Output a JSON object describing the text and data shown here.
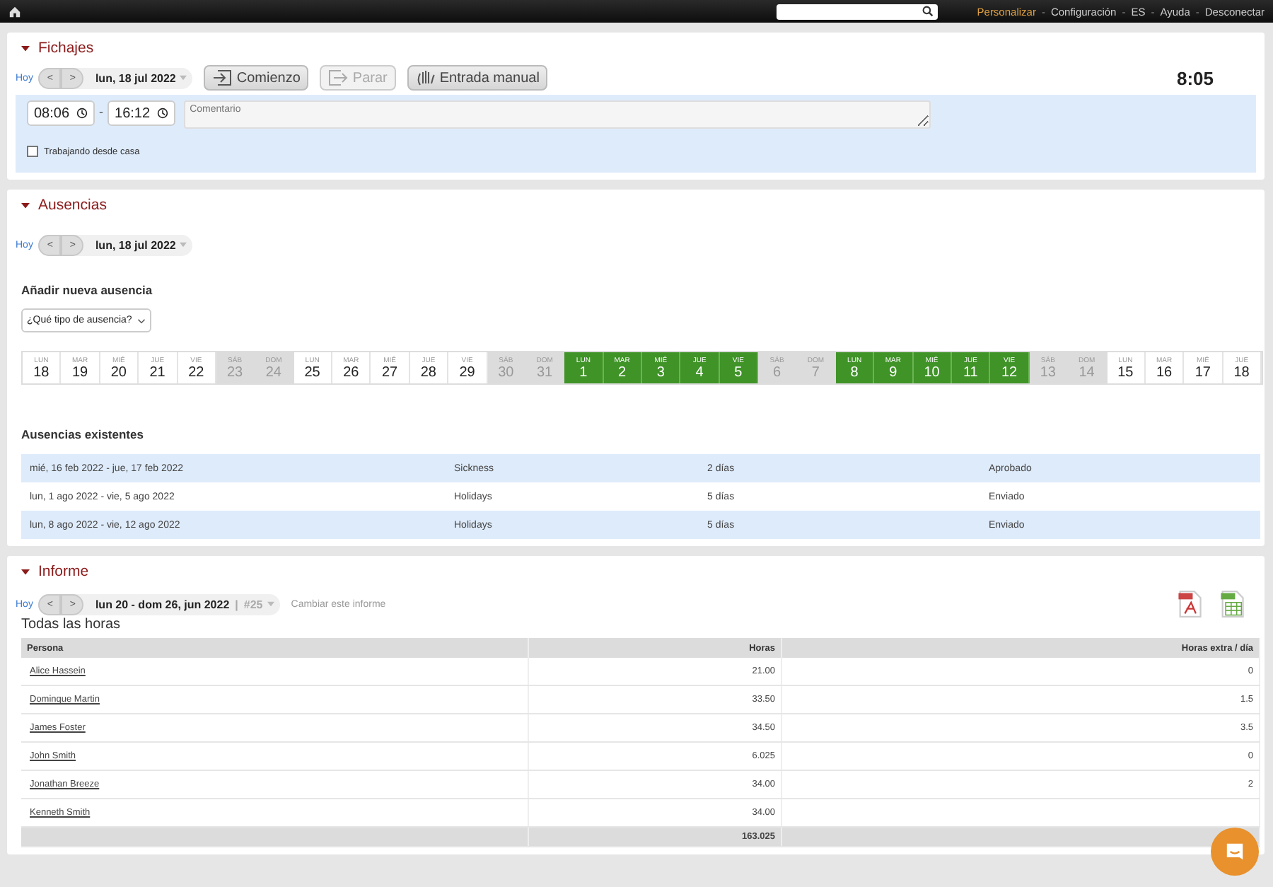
{
  "topbar": {
    "separator": "-",
    "links": [
      {
        "label": "Personalizar",
        "selected": true
      },
      {
        "label": "Configuración",
        "selected": false
      },
      {
        "label": "ES",
        "selected": false
      },
      {
        "label": "Ayuda",
        "selected": false
      },
      {
        "label": "Desconectar",
        "selected": false
      }
    ]
  },
  "fichajes": {
    "title": "Fichajes",
    "expanded": true,
    "today": "Hoy",
    "prev": "<",
    "next": ">",
    "date": "lun, 18 jul 2022",
    "buttons": [
      {
        "label": "Comienzo",
        "disabled": false,
        "kind": "start"
      },
      {
        "label": "Parar",
        "disabled": true,
        "kind": "stop"
      },
      {
        "label": "Entrada manual",
        "disabled": false,
        "kind": "manual"
      }
    ],
    "timer": "8:05",
    "start_time": "08:06",
    "time_separator": "-",
    "end_time": "16:12",
    "comment": {
      "placeholder": "Comentario"
    },
    "home_office": {
      "label": "Trabajando desde casa",
      "checked": false
    }
  },
  "ausencias": {
    "title": "Ausencias",
    "expanded": true,
    "today": "Hoy",
    "prev": "<",
    "next": ">",
    "date": "lun, 18 jul 2022",
    "add_heading": "Añadir nueva ausencia",
    "type_select": "¿Qué tipo de ausencia?",
    "days": [
      {
        "weekday": "LUN",
        "day": "18",
        "kind": "work"
      },
      {
        "weekday": "MAR",
        "day": "19",
        "kind": "work"
      },
      {
        "weekday": "MIÉ",
        "day": "20",
        "kind": "work"
      },
      {
        "weekday": "JUE",
        "day": "21",
        "kind": "work"
      },
      {
        "weekday": "VIE",
        "day": "22",
        "kind": "work"
      },
      {
        "weekday": "SÁB",
        "day": "23",
        "kind": "weekend"
      },
      {
        "weekday": "DOM",
        "day": "24",
        "kind": "weekend"
      },
      {
        "weekday": "LUN",
        "day": "25",
        "kind": "work"
      },
      {
        "weekday": "MAR",
        "day": "26",
        "kind": "work"
      },
      {
        "weekday": "MIÉ",
        "day": "27",
        "kind": "work"
      },
      {
        "weekday": "JUE",
        "day": "28",
        "kind": "work"
      },
      {
        "weekday": "VIE",
        "day": "29",
        "kind": "work"
      },
      {
        "weekday": "SÁB",
        "day": "30",
        "kind": "weekend"
      },
      {
        "weekday": "DOM",
        "day": "31",
        "kind": "weekend"
      },
      {
        "weekday": "LUN",
        "day": "1",
        "kind": "absence"
      },
      {
        "weekday": "MAR",
        "day": "2",
        "kind": "absence"
      },
      {
        "weekday": "MIÉ",
        "day": "3",
        "kind": "absence"
      },
      {
        "weekday": "JUE",
        "day": "4",
        "kind": "absence"
      },
      {
        "weekday": "VIE",
        "day": "5",
        "kind": "absence"
      },
      {
        "weekday": "SÁB",
        "day": "6",
        "kind": "weekend"
      },
      {
        "weekday": "DOM",
        "day": "7",
        "kind": "weekend"
      },
      {
        "weekday": "LUN",
        "day": "8",
        "kind": "absence"
      },
      {
        "weekday": "MAR",
        "day": "9",
        "kind": "absence"
      },
      {
        "weekday": "MIÉ",
        "day": "10",
        "kind": "absence"
      },
      {
        "weekday": "JUE",
        "day": "11",
        "kind": "absence"
      },
      {
        "weekday": "VIE",
        "day": "12",
        "kind": "absence"
      },
      {
        "weekday": "SÁB",
        "day": "13",
        "kind": "weekend"
      },
      {
        "weekday": "DOM",
        "day": "14",
        "kind": "weekend"
      },
      {
        "weekday": "LUN",
        "day": "15",
        "kind": "work"
      },
      {
        "weekday": "MAR",
        "day": "16",
        "kind": "work"
      },
      {
        "weekday": "MIÉ",
        "day": "17",
        "kind": "work"
      },
      {
        "weekday": "JUE",
        "day": "18",
        "kind": "work"
      }
    ],
    "existing_heading": "Ausencias existentes",
    "existing": [
      {
        "period": "mié, 16 feb 2022 - jue, 17 feb 2022",
        "type": "Sickness",
        "duration": "2 días",
        "status": "Aprobado"
      },
      {
        "period": "lun, 1 ago 2022 - vie, 5 ago 2022",
        "type": "Holidays",
        "duration": "5 días",
        "status": "Enviado"
      },
      {
        "period": "lun, 8 ago 2022 - vie, 12 ago 2022",
        "type": "Holidays",
        "duration": "5 días",
        "status": "Enviado"
      }
    ]
  },
  "informe": {
    "title": "Informe",
    "expanded": true,
    "today": "Hoy",
    "prev": "<",
    "next": ">",
    "week": "lun 20 - dom 26, jun 2022",
    "week_separator": "|",
    "week_number": "#25",
    "change_link": "Cambiar este informe",
    "subtitle": "Todas las horas",
    "table": {
      "columns": [
        "Persona",
        "Horas",
        "Horas extra / día"
      ],
      "rows": [
        [
          "Alice Hassein",
          "21.00",
          "0"
        ],
        [
          "Dominque Martin",
          "33.50",
          "1.5"
        ],
        [
          "James Foster",
          "34.50",
          "3.5"
        ],
        [
          "John Smith",
          "6.025",
          "0"
        ],
        [
          "Jonathan Breeze",
          "34.00",
          "2"
        ],
        [
          "Kenneth Smith",
          "34.00"
        ]
      ],
      "total": "163.025"
    }
  }
}
